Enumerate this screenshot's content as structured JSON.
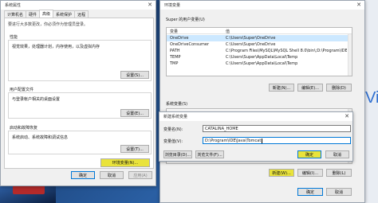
{
  "system_properties": {
    "title": "系统属性",
    "tabs": [
      "计算机名",
      "硬件",
      "高级",
      "系统保护",
      "远程"
    ],
    "active_tab": "高级",
    "performance": {
      "heading": "性能",
      "description": "视觉效果，处理器计划，内存使用，以及虚拟内存",
      "settings_label": "设置(S)..."
    },
    "user_profiles": {
      "heading": "用户配置文件",
      "description": "与登录帐户相关的桌面设置",
      "settings_label": "设置(E)..."
    },
    "startup_recovery": {
      "heading": "启动和故障恢复",
      "description": "系统启动、系统故障和调试信息",
      "settings_label": "设置(T)..."
    },
    "env_vars_label": "环境变量(N)...",
    "ok_label": "确定",
    "cancel_label": "取消",
    "apply_label": "应用(A)"
  },
  "env_window": {
    "title": "环境变量",
    "user_section_label": "Super 的用户变量(U)",
    "col_variable": "变量",
    "col_value": "值",
    "user_vars": [
      {
        "name": "OneDrive",
        "value": "C:\\Users\\Super\\OneDrive"
      },
      {
        "name": "OneDriveConsumer",
        "value": "C:\\Users\\Super\\OneDrive"
      },
      {
        "name": "PATH",
        "value": "C:\\Program Files\\MySQL\\MySQL Shell 8.0\\bin\\;D:\\Program\\IDE\\"
      },
      {
        "name": "TEMP",
        "value": "C:\\Users\\Super\\AppData\\Local\\Temp"
      },
      {
        "name": "TMP",
        "value": "C:\\Users\\Super\\AppData\\Local\\Temp"
      }
    ],
    "user_new_label": "新建(N)...",
    "user_edit_label": "编辑(E)...",
    "user_delete_label": "删除(D)",
    "system_section_label": "系统变量(S)",
    "system_vars": [
      {
        "name": "",
        "value": ""
      },
      {
        "name": "",
        "value": ""
      },
      {
        "name": "",
        "value": ""
      },
      {
        "name": "",
        "value": ""
      },
      {
        "name": "",
        "value": ""
      },
      {
        "name": "",
        "value": ""
      },
      {
        "name": "",
        "value": ""
      },
      {
        "name": "",
        "value": ""
      }
    ],
    "sys_new_label": "新建(W)...",
    "sys_edit_label": "编辑(I)...",
    "sys_delete_label": "删除(L)",
    "ok_label": "确定",
    "cancel_label": "取消"
  },
  "new_var_dialog": {
    "title": "新建系统变量",
    "name_label": "变量名(N):",
    "name_value": "CATALINA_HOME",
    "value_label": "变量值(V):",
    "value_value": "D:\\Program\\IDE\\Java\\Tomcat",
    "browse_dir_label": "浏览目录(D)...",
    "browse_file_label": "浏览文件(F)...",
    "ok_label": "确定",
    "cancel_label": "取消"
  },
  "desktop": {
    "side_text": "Vi"
  }
}
